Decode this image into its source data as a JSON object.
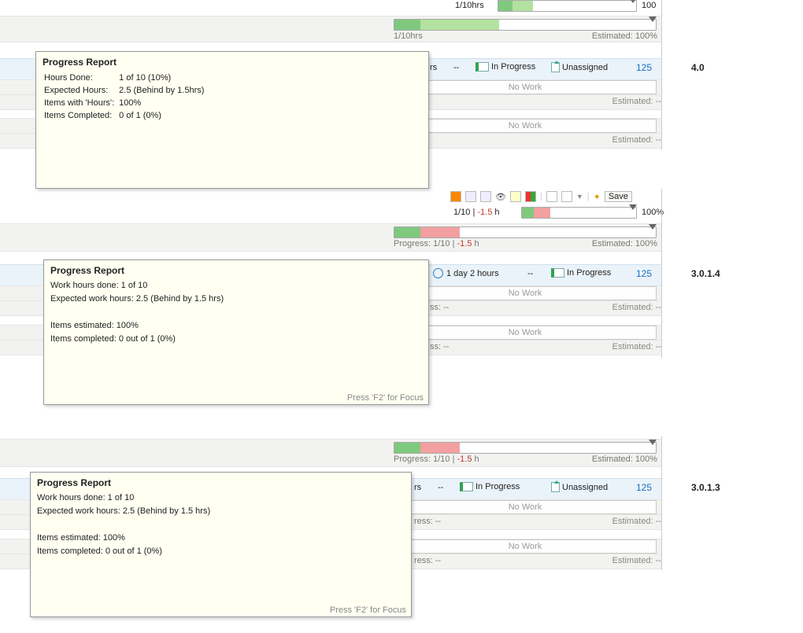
{
  "sections": [
    {
      "version": "4.0",
      "topBar": {
        "label": "1/10hrs",
        "pctText": "100"
      },
      "secondBar": {
        "label": "1/10hrs",
        "estText": "Estimated: 100%"
      },
      "blueRow": {
        "suffix": "rs",
        "dash": "--",
        "status": "In Progress",
        "assignee": "Unassigned",
        "id": "125"
      },
      "rows": [
        {
          "nowork": "No Work",
          "est": "Estimated: --"
        },
        {
          "nowork": "No Work",
          "est": "Estimated: --"
        }
      ],
      "tooltip": {
        "title": "Progress Report",
        "kv": [
          [
            "Hours Done:",
            "1 of 10 (10%)"
          ],
          [
            "Expected Hours:",
            "2.5 (Behind by 1.5hrs)"
          ],
          [
            "Items with 'Hours':",
            "100%"
          ],
          [
            "Items Completed:",
            "0 of 1 (0%)"
          ]
        ]
      }
    },
    {
      "version": "3.0.1.4",
      "toolbar": {
        "save": "Save"
      },
      "topBar": {
        "label": "1/10 | ",
        "behind": "-1.5",
        "unit": " h",
        "pctText": "100%"
      },
      "secondBar": {
        "prefix": "Progress: 1/10 | ",
        "behind": "-1.5",
        "unit": " h",
        "estText": "Estimated: 100%"
      },
      "blueRow": {
        "sched": "1 day 2 hours",
        "dash": "--",
        "status": "In Progress",
        "id": "125"
      },
      "rows": [
        {
          "nowork": "No Work",
          "suffix": "ss: --",
          "est": "Estimated: --"
        },
        {
          "nowork": "No Work",
          "suffix": "ss: --",
          "est": "Estimated: --"
        }
      ],
      "tooltip": {
        "title": "Progress Report",
        "lines": [
          "Work hours done: 1 of 10",
          "Expected work hours: 2.5 (Behind by 1.5 hrs)",
          "",
          "Items estimated: 100%",
          "Items completed: 0 out of 1 (0%)"
        ],
        "footer": "Press 'F2' for Focus"
      }
    },
    {
      "version": "3.0.1.3",
      "secondBar": {
        "prefix": "Progress: 1/10 | ",
        "behind": "-1.5",
        "unit": " h",
        "estText": "Estimated: 100%"
      },
      "blueRow": {
        "suffix": "rs",
        "dash": "--",
        "status": "In Progress",
        "assignee": "Unassigned",
        "id": "125"
      },
      "rows": [
        {
          "nowork": "No Work",
          "suffix": "ress: --",
          "est": "Estimated: --"
        },
        {
          "nowork": "No Work",
          "suffix": "ress: --",
          "est": "Estimated: --"
        }
      ],
      "tooltip": {
        "title": "Progress Report",
        "lines": [
          "Work hours done: 1 of 10",
          "Expected work hours: 2.5 (Behind by 1.5 hrs)",
          "",
          "Items estimated: 100%",
          "Items completed: 0 out of 1 (0%)"
        ],
        "footer": "Press 'F2' for Focus"
      }
    }
  ]
}
